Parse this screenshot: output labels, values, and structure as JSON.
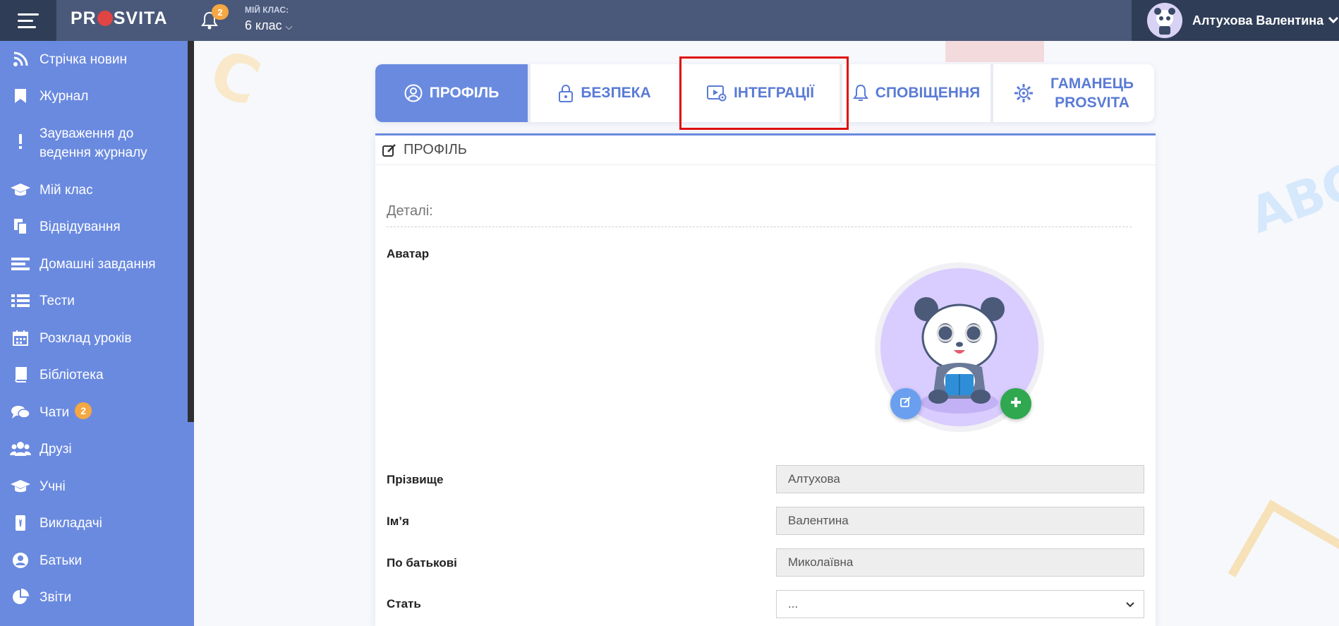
{
  "topbar": {
    "logo": "PROSVITA",
    "logo_left": "PR",
    "logo_right": "SVITA",
    "notifications_count": "2",
    "class_label": "МІЙ КЛАС:",
    "class_value": "6 клас",
    "user_name": "Алтухова Валентина"
  },
  "sidebar": {
    "items": [
      {
        "label": "Стрічка новин",
        "icon": "rss-icon"
      },
      {
        "label": "Журнал",
        "icon": "bookmark-icon"
      },
      {
        "label": "Зауваження до ведення журналу",
        "icon": "exclamation-icon"
      },
      {
        "label": "Мій клас",
        "icon": "graduation-cap-icon"
      },
      {
        "label": "Відвідування",
        "icon": "document-copy-icon"
      },
      {
        "label": "Домашні завдання",
        "icon": "list-icon"
      },
      {
        "label": "Тести",
        "icon": "list-bullets-icon"
      },
      {
        "label": "Розклад уроків",
        "icon": "calendar-icon"
      },
      {
        "label": "Бібліотека",
        "icon": "book-icon"
      },
      {
        "label": "Чати",
        "icon": "chat-icon",
        "badge": "2"
      },
      {
        "label": "Друзі",
        "icon": "users-icon"
      },
      {
        "label": "Учні",
        "icon": "graduation-cap-icon"
      },
      {
        "label": "Викладачі",
        "icon": "teacher-icon"
      },
      {
        "label": "Батьки",
        "icon": "user-circle-icon"
      },
      {
        "label": "Звіти",
        "icon": "pie-chart-icon"
      }
    ]
  },
  "tabs": [
    {
      "label": "ПРОФІЛЬ",
      "icon": "user-circle-icon",
      "active": true
    },
    {
      "label": "БЕЗПЕКА",
      "icon": "lock-icon"
    },
    {
      "label": "ІНТЕГРАЦІЇ",
      "icon": "integration-icon",
      "highlighted": true
    },
    {
      "label": "СПОВІЩЕННЯ",
      "icon": "bell-icon"
    },
    {
      "label": "ГАМАНЕЦЬ PROSVITA",
      "label_line1": "ГАМАНЕЦЬ",
      "label_line2": "PROSVITA",
      "icon": "gear-icon"
    }
  ],
  "profile": {
    "header": "ПРОФІЛЬ",
    "details_title": "Деталі:",
    "avatar_label": "Аватар",
    "fields": [
      {
        "label": "Прізвище",
        "value": "Алтухова"
      },
      {
        "label": "Ім’я",
        "value": "Валентина"
      },
      {
        "label": "По батькові",
        "value": "Миколаївна"
      },
      {
        "label": "Стать",
        "value": "..."
      }
    ]
  },
  "colors": {
    "topbar": "#4a5979",
    "topbar_dark": "#2f3d57",
    "sidebar": "#6a8ae0",
    "accent": "#5a7bd6",
    "badge": "#f5a742",
    "highlight_border": "#e01010",
    "add_button": "#2fa84f",
    "edit_button": "#6a9ff0"
  }
}
